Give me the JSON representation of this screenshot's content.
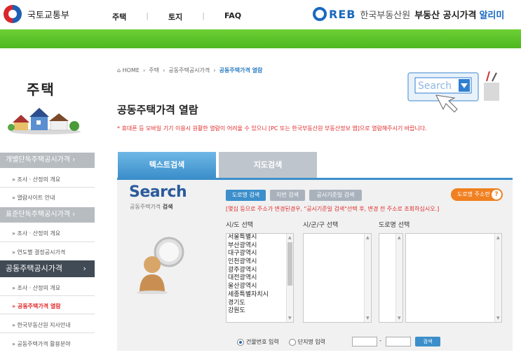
{
  "header": {
    "ministry": "국토교통부",
    "nav": [
      "주택",
      "토지",
      "FAQ"
    ],
    "brand_logo_text": "REB",
    "brand_name": "한국부동산원",
    "brand_title": "부동산 공시가격",
    "brand_notice": "알리미"
  },
  "sidebar": {
    "title": "주택",
    "sections": [
      {
        "label": "개별단독주택공시가격",
        "items": [
          "조사 · 산정의 개요",
          "열람사이트 안내"
        ]
      },
      {
        "label": "표준단독주택공시가격",
        "items": [
          "조사 · 산정의 개요",
          "연도별 결정공시가격"
        ]
      },
      {
        "label": "공동주택공시가격",
        "items": [
          "조사 · 산정의 개요",
          "공동주택가격 열람",
          "한국부동산원 지사안내",
          "공동주택가격 활용분야"
        ]
      }
    ]
  },
  "breadcrumb": [
    "HOME",
    "주택",
    "공동주택공시가격",
    "공동주택가격 열람"
  ],
  "page_title": "공동주택가격 열람",
  "notice": "* 휴대폰 등 모바일 기기 이용시 원활한 열람이 어려울 수 있으니 [PC 또는 한국부동산원 부동산정보 앱]으로 열람해주시기 바랍니다.",
  "illustration": {
    "search_word": "Search"
  },
  "tabs": {
    "text_search": "텍스트검색",
    "map_search": "지도검색"
  },
  "panel": {
    "search_word": "Search",
    "sub": "공동주택가격",
    "sub_bold": "검색",
    "buttons": {
      "road": "도로명 검색",
      "jibun": "지번 검색",
      "date": "공시기준일 검색",
      "road_info": "도로명 주소란",
      "road_info_q": "?"
    },
    "hint": "[몇십 등으로 주소가 변경된경우, \"공시기준일 검색\"선택 후, 변경 전 주소로 조회하십시오.]",
    "columns": {
      "sido": "시/도 선택",
      "sgg": "시/군/구 선택",
      "road": "도로명 선택"
    },
    "sido_options": [
      "서울특별시",
      "부산광역시",
      "대구광역시",
      "인천광역시",
      "광주광역시",
      "대전광역시",
      "울산광역시",
      "세종특별자치시",
      "경기도",
      "강원도"
    ],
    "radio": {
      "building": "건물번호 입력",
      "complex": "단지명 입력"
    },
    "dash": "-",
    "search_button": "검색"
  }
}
